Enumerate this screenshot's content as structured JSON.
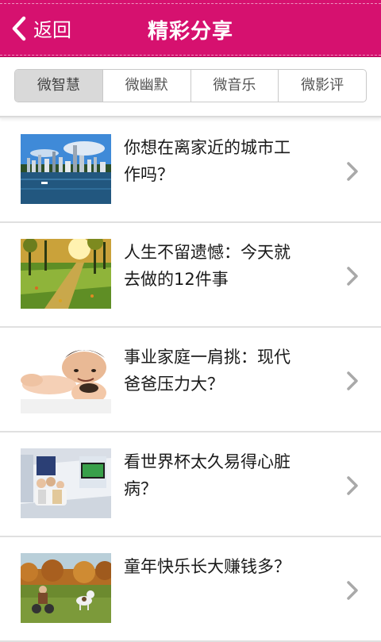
{
  "header": {
    "back_label": "返回",
    "title": "精彩分享",
    "accent": "#d6116f"
  },
  "tabs": [
    {
      "label": "微智慧",
      "active": true
    },
    {
      "label": "微幽默",
      "active": false
    },
    {
      "label": "微音乐",
      "active": false
    },
    {
      "label": "微影评",
      "active": false
    }
  ],
  "articles": [
    {
      "title": "你想在离家近的城市工作吗？",
      "thumb": "city-skyline-image"
    },
    {
      "title": "人生不留遗憾：今天就去做的12件事",
      "thumb": "autumn-park-image"
    },
    {
      "title": "事业家庭一肩挑：现代爸爸压力大？",
      "thumb": "father-baby-image"
    },
    {
      "title": "看世界杯太久易得心脏病？",
      "thumb": "family-tv-room-image"
    },
    {
      "title": "童年快乐长大赚钱多？",
      "thumb": "child-dog-field-image"
    }
  ]
}
